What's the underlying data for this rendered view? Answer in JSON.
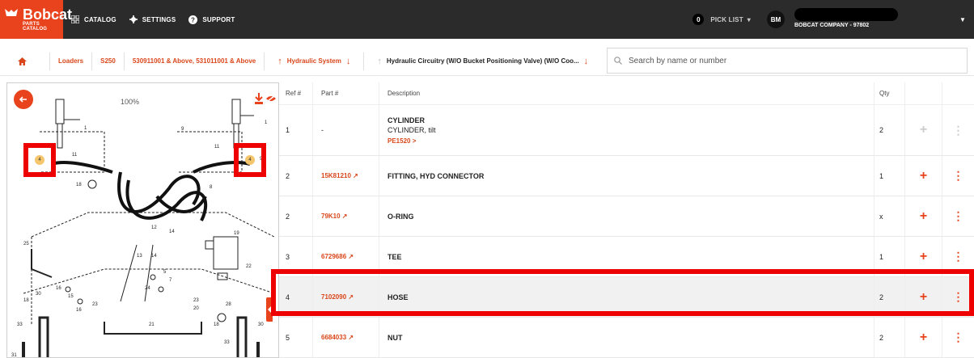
{
  "brand": {
    "name": "Bobcat",
    "sub": "PARTS CATALOG",
    "accent": "#e8431c"
  },
  "nav": [
    {
      "label": "CATALOG",
      "icon": "grid-icon"
    },
    {
      "label": "SETTINGS",
      "icon": "gear-icon"
    },
    {
      "label": "SUPPORT",
      "icon": "help-icon"
    }
  ],
  "picklist": {
    "count": "0",
    "label": "PICK LIST"
  },
  "user": {
    "initials": "BM",
    "company": "BOBCAT COMPANY - 97802"
  },
  "breadcrumb": {
    "items": [
      "Loaders",
      "S250",
      "530911001 & Above, 531011001 & Above",
      "Hydraulic System",
      "Hydraulic Circuitry (W/O Bucket Positioning Valve) (W/O Coo..."
    ]
  },
  "search": {
    "placeholder": "Search by name or number"
  },
  "diagram": {
    "zoom": "100%",
    "hotspot_label": "4"
  },
  "table": {
    "headers": {
      "ref": "Ref #",
      "part": "Part #",
      "desc": "Description",
      "qty": "Qty"
    },
    "rows": [
      {
        "ref": "1",
        "part": "-",
        "desc": "CYLINDER",
        "sub": "CYLINDER, tilt",
        "link": "PE1520 >",
        "qty": "2",
        "enabled": false
      },
      {
        "ref": "2",
        "part": "15K81210",
        "desc": "FITTING, HYD CONNECTOR",
        "qty": "1",
        "enabled": true
      },
      {
        "ref": "2",
        "part": "79K10",
        "desc": "O-RING",
        "qty": "x",
        "enabled": true
      },
      {
        "ref": "3",
        "part": "6729686",
        "desc": "TEE",
        "qty": "1",
        "enabled": true
      },
      {
        "ref": "4",
        "part": "7102090",
        "desc": "HOSE",
        "qty": "2",
        "enabled": true,
        "selected": true
      },
      {
        "ref": "5",
        "part": "6684033",
        "desc": "NUT",
        "qty": "2",
        "enabled": true
      }
    ]
  }
}
